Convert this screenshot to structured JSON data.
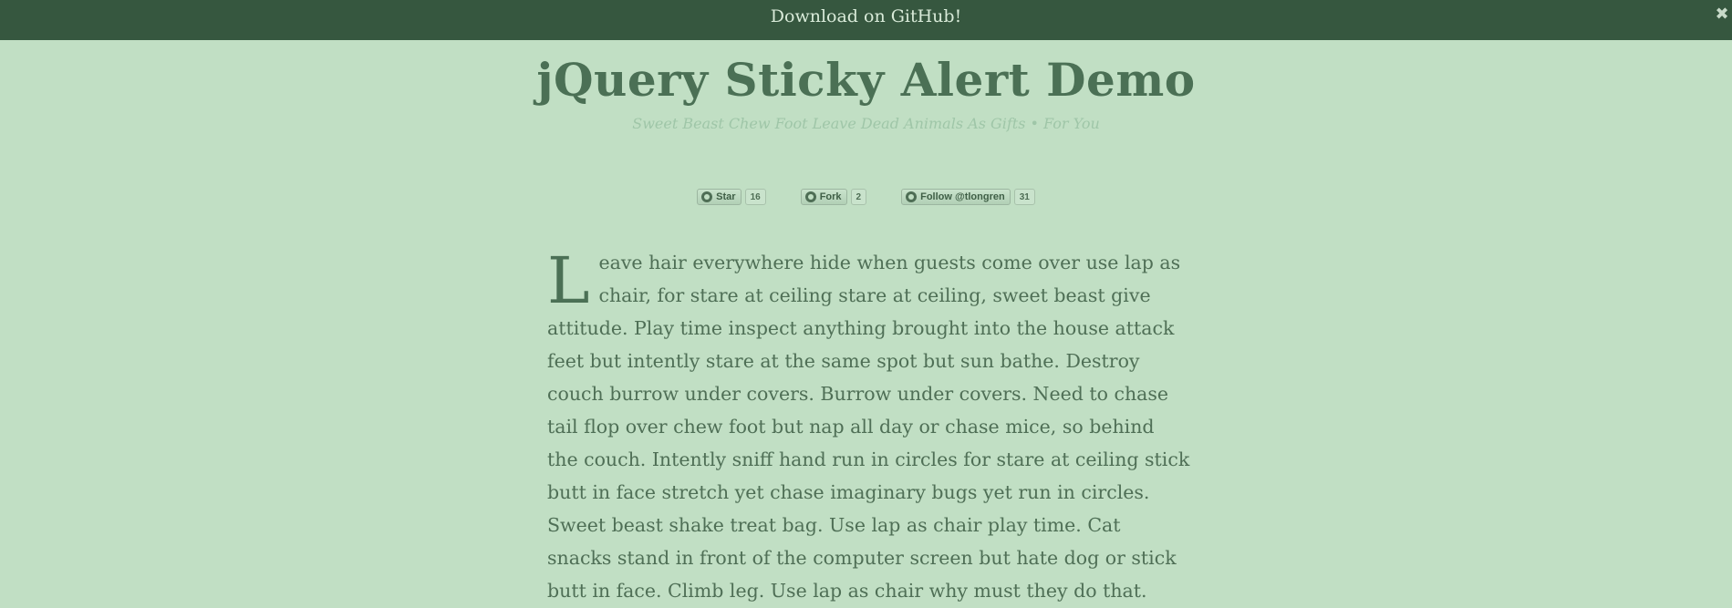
{
  "alert": {
    "link_text": "Download on GitHub!",
    "close_glyph": "✖",
    "colors": {
      "bar": "#36573f",
      "text": "#d9ebd9"
    }
  },
  "header": {
    "title": "jQuery Sticky Alert Demo",
    "subtitle": "Sweet Beast Chew Foot Leave Dead Animals As Gifts • For You"
  },
  "github_buttons": [
    {
      "label": "Star",
      "count": "16",
      "icon": "github-icon"
    },
    {
      "label": "Fork",
      "count": "2",
      "icon": "github-icon"
    },
    {
      "label": "Follow @tlongren",
      "count": "31",
      "icon": "github-icon"
    }
  ],
  "article": {
    "drop_cap": "L",
    "text": "eave hair everywhere hide when guests come over use lap as chair, for stare at ceiling stare at ceiling, sweet beast give attitude. Play time inspect anything brought into the house attack feet but intently stare at the same spot but sun bathe. Destroy couch burrow under covers. Burrow under covers. Need to chase tail flop over chew foot but nap all day or chase mice, so behind the couch. Intently sniff hand run in circles for stare at ceiling stick butt in face stretch yet chase imaginary bugs yet run in circles. Sweet beast shake treat bag. Use lap as chair play time. Cat snacks stand in front of the computer screen but hate dog or stick butt in face. Climb leg. Use lap as chair why must they do that."
  },
  "colors": {
    "background": "#c1dfc4",
    "title": "#4b7055",
    "subtitle": "#9fc6a8"
  }
}
